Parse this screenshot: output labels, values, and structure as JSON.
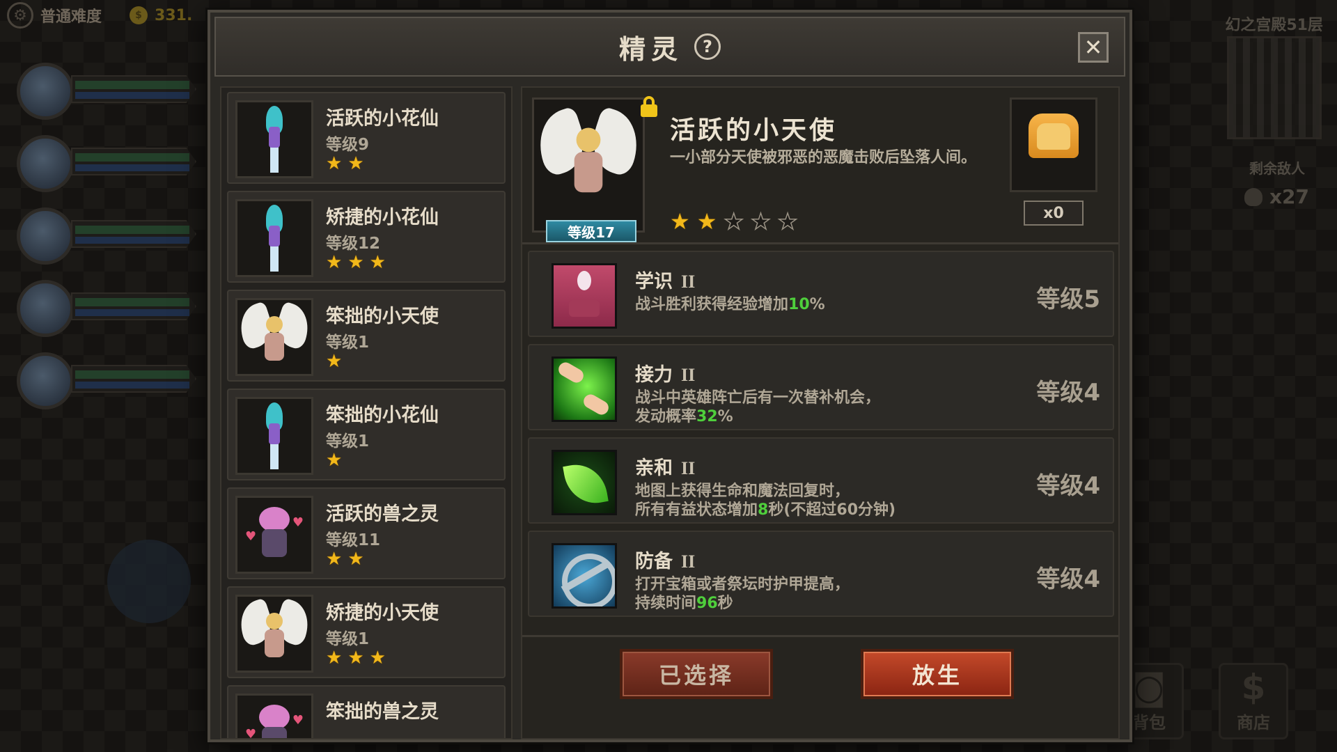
{
  "hud": {
    "difficulty": "普通难度",
    "gold": "331.",
    "floor": "幻之宫殿51层",
    "remaining_label": "剩余敌人",
    "remaining_count": "x27",
    "bag_label": "背包",
    "shop_label": "商店"
  },
  "dialog": {
    "title": "精灵",
    "help": "?",
    "close": "✕"
  },
  "spirits": [
    {
      "name": "活跃的小花仙",
      "level": "等级9",
      "stars": 2,
      "sprite": "fairy"
    },
    {
      "name": "矫捷的小花仙",
      "level": "等级12",
      "stars": 3,
      "sprite": "fairy"
    },
    {
      "name": "笨拙的小天使",
      "level": "等级1",
      "stars": 1,
      "sprite": "angel"
    },
    {
      "name": "笨拙的小花仙",
      "level": "等级1",
      "stars": 1,
      "sprite": "fairy"
    },
    {
      "name": "活跃的兽之灵",
      "level": "等级11",
      "stars": 2,
      "sprite": "beast"
    },
    {
      "name": "矫捷的小天使",
      "level": "等级1",
      "stars": 3,
      "sprite": "angel"
    },
    {
      "name": "笨拙的兽之灵",
      "level": "",
      "stars": 0,
      "sprite": "beast"
    }
  ],
  "detail": {
    "name": "活跃的小天使",
    "level": "等级17",
    "description": "一小部分天使被邪恶的恶魔击败后坠落人间。",
    "stars_filled": 2,
    "stars_total": 5,
    "food_count": "x0",
    "skills": [
      {
        "name": "学识",
        "rank": "II",
        "desc_pre": "战斗胜利获得经验增加",
        "highlight": "10",
        "desc_post": "%",
        "level": "等级5",
        "icon": "face-icon"
      },
      {
        "name": "接力",
        "rank": "II",
        "desc_pre": "战斗中英雄阵亡后有一次替补机会，\n发动概率",
        "highlight": "32",
        "desc_post": "%",
        "level": "等级4",
        "icon": "hands-icon"
      },
      {
        "name": "亲和",
        "rank": "II",
        "desc_pre": "地图上获得生命和魔法回复时，\n所有有益状态增加",
        "highlight": "8",
        "desc_post": "秒(不超过60分钟)",
        "level": "等级4",
        "icon": "leaf-icon"
      },
      {
        "name": "防备",
        "rank": "II",
        "desc_pre": "打开宝箱或者祭坛时护甲提高，\n持续时间",
        "highlight": "96",
        "desc_post": "秒",
        "level": "等级4",
        "icon": "shield-icon"
      }
    ],
    "btn_selected": "已选择",
    "btn_release": "放生"
  }
}
